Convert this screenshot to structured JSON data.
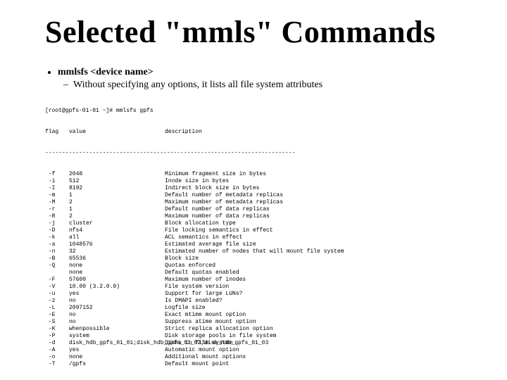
{
  "title": "Selected \"mmls\" Commands",
  "bullet": {
    "cmd": "mmlsfs <device name>",
    "desc": "Without specifying any options, it lists all file system attributes"
  },
  "terminal": {
    "prompt": "[root@gpfs-01-01 ~]# mmlsfs gpfs",
    "header": {
      "c1": "flag",
      "c2": "value",
      "c3": "description"
    },
    "divider": "--------------------------------------------------------------------------",
    "rows": [
      {
        "f": " -f",
        "v": "2048",
        "d": "Minimum fragment size in bytes"
      },
      {
        "f": " -i",
        "v": "512",
        "d": "Inode size in bytes"
      },
      {
        "f": " -I",
        "v": "8192",
        "d": "Indirect block size in bytes"
      },
      {
        "f": " -m",
        "v": "1",
        "d": "Default number of metadata replicas"
      },
      {
        "f": " -M",
        "v": "2",
        "d": "Maximum number of metadata replicas"
      },
      {
        "f": " -r",
        "v": "1",
        "d": "Default number of data replicas"
      },
      {
        "f": " -R",
        "v": "2",
        "d": "Maximum number of data replicas"
      },
      {
        "f": " -j",
        "v": "cluster",
        "d": "Block allocation type"
      },
      {
        "f": " -D",
        "v": "nfs4",
        "d": "File locking semantics in effect"
      },
      {
        "f": " -k",
        "v": "all",
        "d": "ACL semantics in effect"
      },
      {
        "f": " -a",
        "v": "1048576",
        "d": "Estimated average file size"
      },
      {
        "f": " -n",
        "v": "32",
        "d": "Estimated number of nodes that will mount file system"
      },
      {
        "f": " -B",
        "v": "65536",
        "d": "Block size"
      },
      {
        "f": " -Q",
        "v": "none",
        "d": "Quotas enforced"
      },
      {
        "f": "",
        "v": "none",
        "d": "Default quotas enabled"
      },
      {
        "f": " -F",
        "v": "57600",
        "d": "Maximum number of inodes"
      },
      {
        "f": " -V",
        "v": "10.00 (3.2.0.0)",
        "d": "File system version"
      },
      {
        "f": " -u",
        "v": "yes",
        "d": "Support for large LUNs?"
      },
      {
        "f": " -z",
        "v": "no",
        "d": "Is DMAPI enabled?"
      },
      {
        "f": " -L",
        "v": "2097152",
        "d": "Logfile size"
      },
      {
        "f": " -E",
        "v": "no",
        "d": "Exact mtime mount option"
      },
      {
        "f": " -S",
        "v": "no",
        "d": "Suppress atime mount option"
      },
      {
        "f": " -K",
        "v": "whenpossible",
        "d": "Strict replica allocation option"
      },
      {
        "f": " -P",
        "v": "system",
        "d": "Disk storage pools in file system"
      },
      {
        "f": " -d",
        "v": "disk_hdb_gpfs_01_01;disk_hdb_gpfs_01_02;disk_hdb_gpfs_01_03",
        "d": "Disks in file system"
      },
      {
        "f": " -A",
        "v": "yes",
        "d": "Automatic mount option"
      },
      {
        "f": " -o",
        "v": "none",
        "d": "Additional mount options"
      },
      {
        "f": " -T",
        "v": "/gpfs",
        "d": "Default mount point"
      }
    ]
  }
}
